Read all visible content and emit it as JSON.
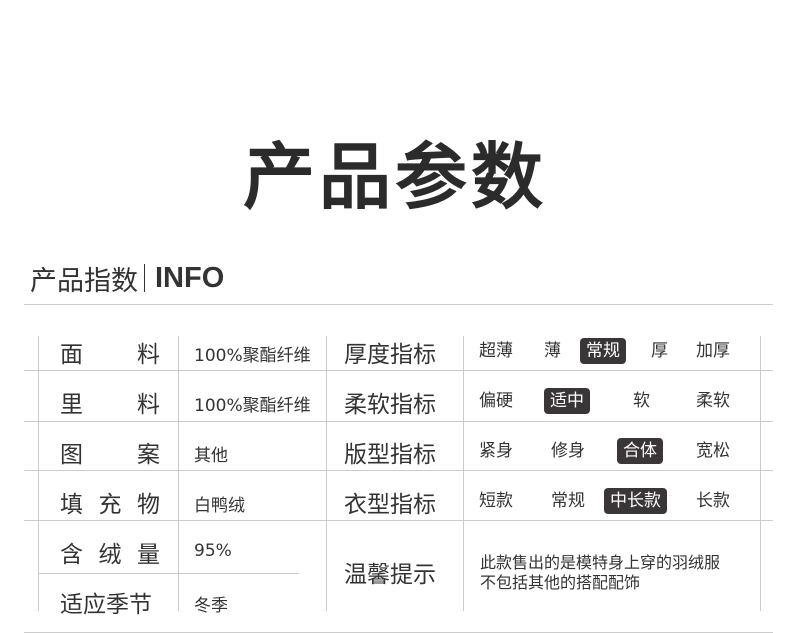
{
  "title": "产品参数",
  "section": {
    "cn": "产品指数",
    "en": "INFO"
  },
  "left_rows": [
    {
      "label": [
        "面",
        "料"
      ],
      "value": "100%聚酯纤维"
    },
    {
      "label": [
        "里",
        "料"
      ],
      "value": "100%聚酯纤维"
    },
    {
      "label": [
        "图",
        "案"
      ],
      "value": "其他"
    },
    {
      "label": [
        "填",
        "充",
        "物"
      ],
      "value": "白鸭绒"
    },
    {
      "label": [
        "含",
        "绒",
        "量"
      ],
      "value": "95%"
    },
    {
      "label": [
        "适应季节"
      ],
      "value": "冬季"
    }
  ],
  "right_rows": [
    {
      "label": "厚度指标",
      "options": [
        "超薄",
        "薄",
        "常规",
        "厚",
        "加厚"
      ],
      "selected": "常规"
    },
    {
      "label": "柔软指标",
      "options": [
        "偏硬",
        "适中",
        "软",
        "柔软"
      ],
      "selected": "适中"
    },
    {
      "label": "版型指标",
      "options": [
        "紧身",
        "修身",
        "合体",
        "宽松"
      ],
      "selected": "合体"
    },
    {
      "label": "衣型指标",
      "options": [
        "短款",
        "常规",
        "中长款",
        "长款"
      ],
      "selected": "中长款"
    }
  ],
  "tip": {
    "label": "温馨提示",
    "lines": [
      "此款售出的是模特身上穿的羽绒服",
      "不包括其他的搭配配饰"
    ]
  },
  "colors": {
    "selected_bg": "#3a3637",
    "line": "#cccccc",
    "text": "#333333"
  }
}
